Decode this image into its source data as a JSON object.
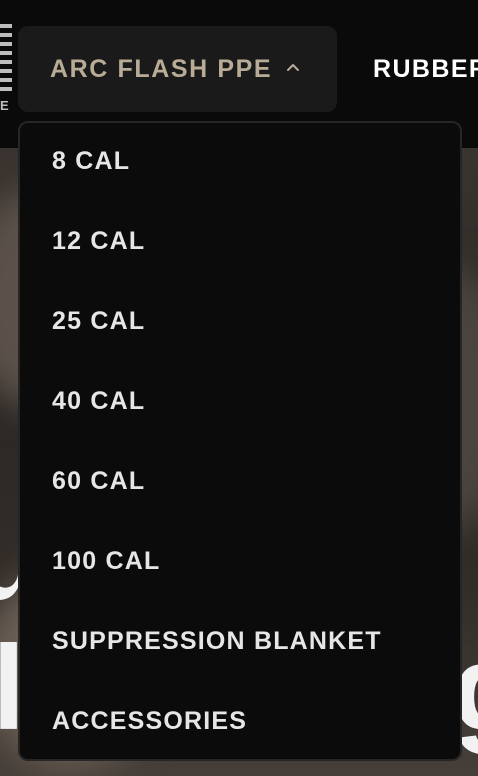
{
  "nav": {
    "logo_letter": "E",
    "active_menu": {
      "label": "ARC FLASH PPE",
      "expanded": true,
      "icon": "chevron-up-icon"
    },
    "next_link": "RUBBER"
  },
  "dropdown": {
    "items": [
      {
        "label": "8 CAL"
      },
      {
        "label": "12 CAL"
      },
      {
        "label": "25 CAL"
      },
      {
        "label": "40 CAL"
      },
      {
        "label": "60 CAL"
      },
      {
        "label": "100 CAL"
      },
      {
        "label": "SUPPRESSION BLANKET"
      },
      {
        "label": "ACCESSORIES"
      }
    ]
  },
  "colors": {
    "nav_background": "#0a0a0a",
    "active_button_background": "#1a1a1a",
    "active_label": "#b8ac97",
    "dropdown_background": "#0b0b0b",
    "dropdown_text": "#e6e6e6"
  }
}
